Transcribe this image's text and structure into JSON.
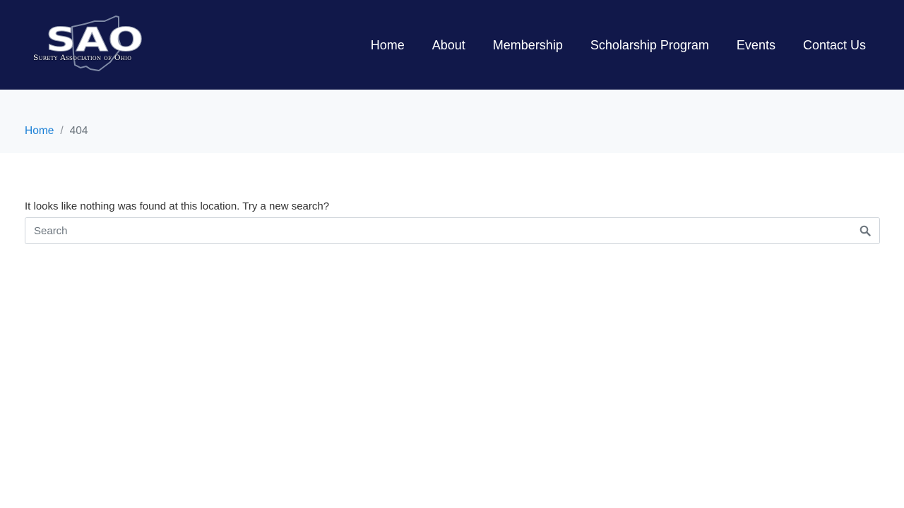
{
  "header": {
    "logo": {
      "letters": "SAO",
      "subtitle": "Surety Association of Ohio",
      "icon": "ohio-state-outline-icon"
    },
    "nav": [
      "Home",
      "About",
      "Membership",
      "Scholarship Program",
      "Events",
      "Contact Us"
    ]
  },
  "breadcrumb": {
    "home": "Home",
    "separator": "/",
    "current": "404"
  },
  "main": {
    "message": "It looks like nothing was found at this location. Try a new search?",
    "search": {
      "placeholder": "Search",
      "value": "",
      "button_icon": "search-icon"
    }
  },
  "colors": {
    "header_bg": "#11184a",
    "breadcrumb_bg": "#f7f9fb",
    "link": "#1a7fd6",
    "text": "#333333"
  }
}
